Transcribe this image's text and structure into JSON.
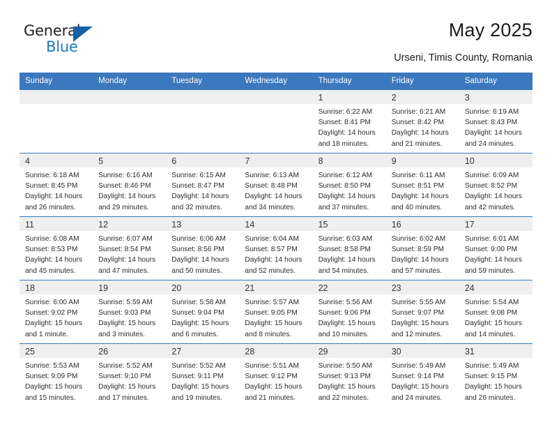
{
  "brand": {
    "name_top": "General",
    "name_bottom": "Blue"
  },
  "header": {
    "title": "May 2025",
    "subtitle": "Urseni, Timis County, Romania"
  },
  "colors": {
    "header_blue": "#3B78BD",
    "brand_blue": "#1B77C4",
    "daynum_band": "#EFEFEF"
  },
  "calendar": {
    "weekday_headers": [
      "Sunday",
      "Monday",
      "Tuesday",
      "Wednesday",
      "Thursday",
      "Friday",
      "Saturday"
    ],
    "labels": {
      "sunrise": "Sunrise:",
      "sunset": "Sunset:",
      "daylight": "Daylight:"
    },
    "weeks": [
      [
        {
          "day": "",
          "empty": true
        },
        {
          "day": "",
          "empty": true
        },
        {
          "day": "",
          "empty": true
        },
        {
          "day": "",
          "empty": true
        },
        {
          "day": "1",
          "sunrise": "Sunrise: 6:22 AM",
          "sunset": "Sunset: 8:41 PM",
          "daylight": "Daylight: 14 hours and 18 minutes."
        },
        {
          "day": "2",
          "sunrise": "Sunrise: 6:21 AM",
          "sunset": "Sunset: 8:42 PM",
          "daylight": "Daylight: 14 hours and 21 minutes."
        },
        {
          "day": "3",
          "sunrise": "Sunrise: 6:19 AM",
          "sunset": "Sunset: 8:43 PM",
          "daylight": "Daylight: 14 hours and 24 minutes."
        }
      ],
      [
        {
          "day": "4",
          "sunrise": "Sunrise: 6:18 AM",
          "sunset": "Sunset: 8:45 PM",
          "daylight": "Daylight: 14 hours and 26 minutes."
        },
        {
          "day": "5",
          "sunrise": "Sunrise: 6:16 AM",
          "sunset": "Sunset: 8:46 PM",
          "daylight": "Daylight: 14 hours and 29 minutes."
        },
        {
          "day": "6",
          "sunrise": "Sunrise: 6:15 AM",
          "sunset": "Sunset: 8:47 PM",
          "daylight": "Daylight: 14 hours and 32 minutes."
        },
        {
          "day": "7",
          "sunrise": "Sunrise: 6:13 AM",
          "sunset": "Sunset: 8:48 PM",
          "daylight": "Daylight: 14 hours and 34 minutes."
        },
        {
          "day": "8",
          "sunrise": "Sunrise: 6:12 AM",
          "sunset": "Sunset: 8:50 PM",
          "daylight": "Daylight: 14 hours and 37 minutes."
        },
        {
          "day": "9",
          "sunrise": "Sunrise: 6:11 AM",
          "sunset": "Sunset: 8:51 PM",
          "daylight": "Daylight: 14 hours and 40 minutes."
        },
        {
          "day": "10",
          "sunrise": "Sunrise: 6:09 AM",
          "sunset": "Sunset: 8:52 PM",
          "daylight": "Daylight: 14 hours and 42 minutes."
        }
      ],
      [
        {
          "day": "11",
          "sunrise": "Sunrise: 6:08 AM",
          "sunset": "Sunset: 8:53 PM",
          "daylight": "Daylight: 14 hours and 45 minutes."
        },
        {
          "day": "12",
          "sunrise": "Sunrise: 6:07 AM",
          "sunset": "Sunset: 8:54 PM",
          "daylight": "Daylight: 14 hours and 47 minutes."
        },
        {
          "day": "13",
          "sunrise": "Sunrise: 6:06 AM",
          "sunset": "Sunset: 8:56 PM",
          "daylight": "Daylight: 14 hours and 50 minutes."
        },
        {
          "day": "14",
          "sunrise": "Sunrise: 6:04 AM",
          "sunset": "Sunset: 8:57 PM",
          "daylight": "Daylight: 14 hours and 52 minutes."
        },
        {
          "day": "15",
          "sunrise": "Sunrise: 6:03 AM",
          "sunset": "Sunset: 8:58 PM",
          "daylight": "Daylight: 14 hours and 54 minutes."
        },
        {
          "day": "16",
          "sunrise": "Sunrise: 6:02 AM",
          "sunset": "Sunset: 8:59 PM",
          "daylight": "Daylight: 14 hours and 57 minutes."
        },
        {
          "day": "17",
          "sunrise": "Sunrise: 6:01 AM",
          "sunset": "Sunset: 9:00 PM",
          "daylight": "Daylight: 14 hours and 59 minutes."
        }
      ],
      [
        {
          "day": "18",
          "sunrise": "Sunrise: 6:00 AM",
          "sunset": "Sunset: 9:02 PM",
          "daylight": "Daylight: 15 hours and 1 minute."
        },
        {
          "day": "19",
          "sunrise": "Sunrise: 5:59 AM",
          "sunset": "Sunset: 9:03 PM",
          "daylight": "Daylight: 15 hours and 3 minutes."
        },
        {
          "day": "20",
          "sunrise": "Sunrise: 5:58 AM",
          "sunset": "Sunset: 9:04 PM",
          "daylight": "Daylight: 15 hours and 6 minutes."
        },
        {
          "day": "21",
          "sunrise": "Sunrise: 5:57 AM",
          "sunset": "Sunset: 9:05 PM",
          "daylight": "Daylight: 15 hours and 8 minutes."
        },
        {
          "day": "22",
          "sunrise": "Sunrise: 5:56 AM",
          "sunset": "Sunset: 9:06 PM",
          "daylight": "Daylight: 15 hours and 10 minutes."
        },
        {
          "day": "23",
          "sunrise": "Sunrise: 5:55 AM",
          "sunset": "Sunset: 9:07 PM",
          "daylight": "Daylight: 15 hours and 12 minutes."
        },
        {
          "day": "24",
          "sunrise": "Sunrise: 5:54 AM",
          "sunset": "Sunset: 9:08 PM",
          "daylight": "Daylight: 15 hours and 14 minutes."
        }
      ],
      [
        {
          "day": "25",
          "sunrise": "Sunrise: 5:53 AM",
          "sunset": "Sunset: 9:09 PM",
          "daylight": "Daylight: 15 hours and 15 minutes."
        },
        {
          "day": "26",
          "sunrise": "Sunrise: 5:52 AM",
          "sunset": "Sunset: 9:10 PM",
          "daylight": "Daylight: 15 hours and 17 minutes."
        },
        {
          "day": "27",
          "sunrise": "Sunrise: 5:52 AM",
          "sunset": "Sunset: 9:11 PM",
          "daylight": "Daylight: 15 hours and 19 minutes."
        },
        {
          "day": "28",
          "sunrise": "Sunrise: 5:51 AM",
          "sunset": "Sunset: 9:12 PM",
          "daylight": "Daylight: 15 hours and 21 minutes."
        },
        {
          "day": "29",
          "sunrise": "Sunrise: 5:50 AM",
          "sunset": "Sunset: 9:13 PM",
          "daylight": "Daylight: 15 hours and 22 minutes."
        },
        {
          "day": "30",
          "sunrise": "Sunrise: 5:49 AM",
          "sunset": "Sunset: 9:14 PM",
          "daylight": "Daylight: 15 hours and 24 minutes."
        },
        {
          "day": "31",
          "sunrise": "Sunrise: 5:49 AM",
          "sunset": "Sunset: 9:15 PM",
          "daylight": "Daylight: 15 hours and 26 minutes."
        }
      ]
    ]
  }
}
